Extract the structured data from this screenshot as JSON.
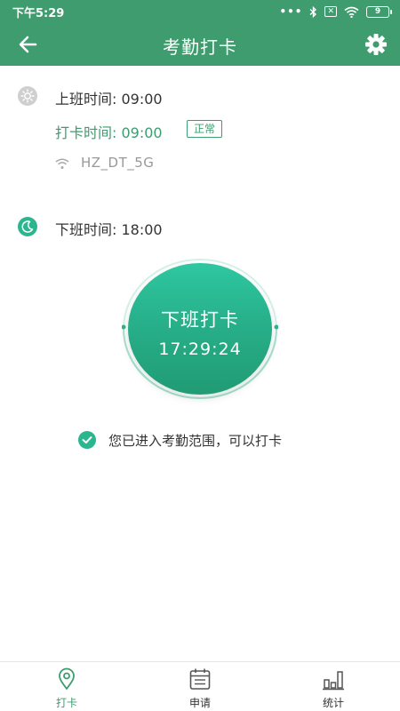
{
  "status_bar": {
    "time": "下午5:29",
    "icons": [
      "more-dots-icon",
      "bluetooth-icon",
      "sim-blocked-icon",
      "wifi-icon",
      "battery-icon"
    ],
    "battery": "9"
  },
  "app_bar": {
    "title": "考勤打卡",
    "back_icon": "arrow-left-icon",
    "settings_icon": "gear-icon"
  },
  "work_start": {
    "icon": "sun-icon",
    "label": "上班时间: 09:00"
  },
  "clock_in": {
    "label": "打卡时间: 09:00",
    "status": "正常",
    "network_icon": "wifi-icon",
    "network": "HZ_DT_5G"
  },
  "work_end": {
    "icon": "moon-icon",
    "label": "下班时间: 18:00"
  },
  "punch_button": {
    "label": "下班打卡",
    "time": "17:29:24"
  },
  "range_notice": {
    "icon": "check-icon",
    "text": "您已进入考勤范围，可以打卡"
  },
  "tab_bar": {
    "tabs": [
      {
        "label": "打卡",
        "icon": "location-pin-icon",
        "active": true
      },
      {
        "label": "申请",
        "icon": "calendar-icon",
        "active": false
      },
      {
        "label": "统计",
        "icon": "bar-chart-icon",
        "active": false
      }
    ]
  },
  "colors": {
    "primary": "#3e9c6e",
    "accent": "#2bb68f",
    "text": "#333333",
    "muted": "#999999"
  }
}
